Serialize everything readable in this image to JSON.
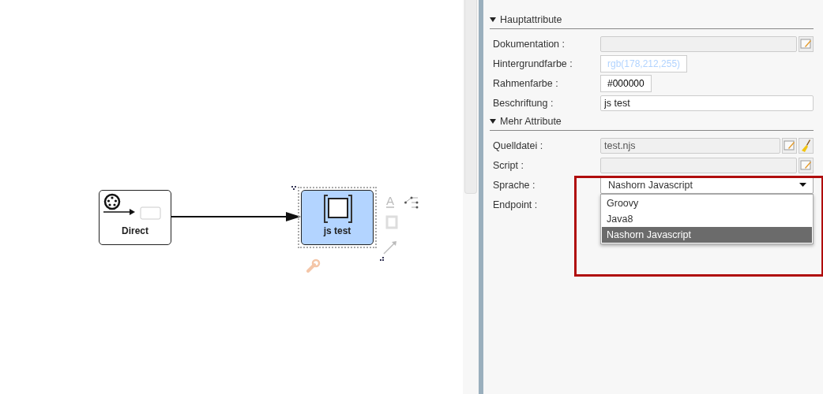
{
  "diagram": {
    "nodes": [
      {
        "kind": "endpoint",
        "label": "Direct",
        "selected": false
      },
      {
        "kind": "script",
        "label": "js test",
        "selected": true
      }
    ],
    "edit_tools": {
      "label_glyph": "A"
    }
  },
  "properties": {
    "sections": [
      {
        "title": "Hauptattribute",
        "expanded": true,
        "fields": [
          {
            "kind": "text",
            "label": "Dokumentation :",
            "readonly": true,
            "edit_button": true,
            "clear_button": false
          },
          {
            "kind": "color",
            "label": "Hintergrundfarbe :",
            "value": "rgb(178,212,255)"
          },
          {
            "kind": "color",
            "label": "Rahmenfarbe :",
            "value": "#000000"
          },
          {
            "kind": "text",
            "label": "Beschriftung :",
            "value": "js test",
            "readonly": false,
            "edit_button": false,
            "clear_button": false
          }
        ]
      },
      {
        "title": "Mehr Attribute",
        "expanded": true,
        "fields": [
          {
            "kind": "text",
            "label": "Quelldatei :",
            "value": "test.njs",
            "readonly": true,
            "edit_button": true,
            "clear_button": true
          },
          {
            "kind": "text",
            "label": "Script :",
            "readonly": true,
            "edit_button": true,
            "clear_button": false
          },
          {
            "kind": "select",
            "label": "Sprache :",
            "value": "Nashorn Javascript",
            "open": true,
            "options": [
              {
                "label": "Groovy",
                "selected": false
              },
              {
                "label": "Java8",
                "selected": false
              },
              {
                "label": "Nashorn Javascript",
                "selected": true
              }
            ]
          },
          {
            "kind": "empty",
            "label": "Endpoint :"
          }
        ]
      }
    ]
  }
}
